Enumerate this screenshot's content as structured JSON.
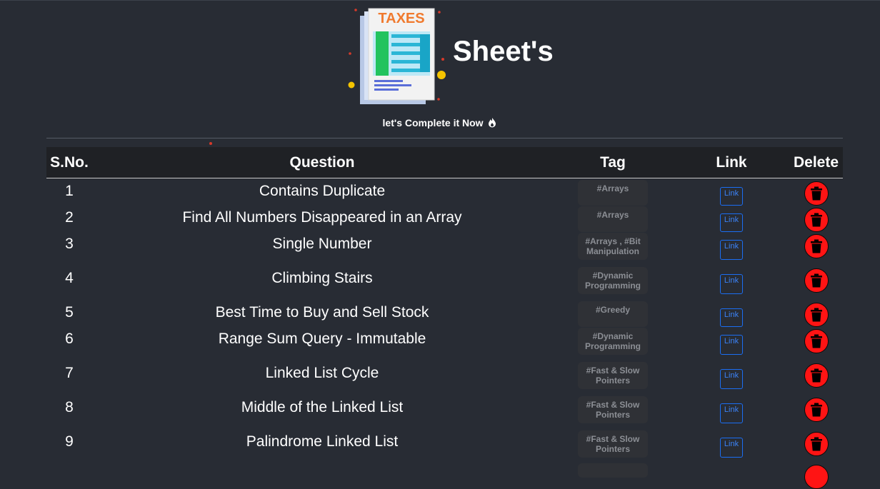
{
  "header": {
    "logo_text": "TAXES",
    "brand": "Sheet's",
    "tagline": "let's Complete it Now"
  },
  "table": {
    "columns": [
      "S.No.",
      "Question",
      "Tag",
      "Link",
      "Delete"
    ],
    "rows": [
      {
        "sno": "1",
        "question": "Contains Duplicate",
        "tag": "#Arrays",
        "link": "Link"
      },
      {
        "sno": "2",
        "question": "Find All Numbers Disappeared in an Array",
        "tag": "#Arrays",
        "link": "Link"
      },
      {
        "sno": "3",
        "question": "Single Number",
        "tag": "#Arrays , #Bit Manipulation",
        "link": "Link"
      },
      {
        "sno": "4",
        "question": "Climbing Stairs",
        "tag": "#Dynamic Programming",
        "link": "Link"
      },
      {
        "sno": "5",
        "question": "Best Time to Buy and Sell Stock",
        "tag": "#Greedy",
        "link": "Link"
      },
      {
        "sno": "6",
        "question": "Range Sum Query - Immutable",
        "tag": "#Dynamic Programming",
        "link": "Link"
      },
      {
        "sno": "7",
        "question": "Linked List Cycle",
        "tag": "#Fast & Slow Pointers",
        "link": "Link"
      },
      {
        "sno": "8",
        "question": "Middle of the Linked List",
        "tag": "#Fast & Slow Pointers",
        "link": "Link"
      },
      {
        "sno": "9",
        "question": "Palindrome Linked List",
        "tag": "#Fast & Slow Pointers",
        "link": "Link"
      }
    ]
  },
  "icons": {
    "logo": "tax-document-icon",
    "tagline": "fire-drop-icon",
    "delete": "trash-icon"
  },
  "colors": {
    "background": "#282c34",
    "header_row": "#1f2125",
    "tag_bg": "#2f3136",
    "link": "#1b6ef3",
    "delete": "#ff1414"
  }
}
